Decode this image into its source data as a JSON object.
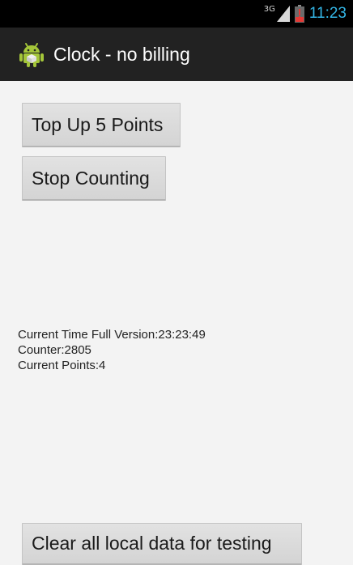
{
  "status_bar": {
    "network_type": "3G",
    "time": "11:23",
    "clock_color": "#33b5e5",
    "icons": [
      "signal-icon",
      "battery-low-icon"
    ]
  },
  "action_bar": {
    "app_icon": "android-icon",
    "title": "Clock - no billing"
  },
  "buttons": {
    "top_up": "Top Up 5 Points",
    "stop_counting": "Stop Counting",
    "clear_data": "Clear all local data for testing"
  },
  "info": {
    "current_time": "Current Time Full Version:23:23:49",
    "counter": "Counter:2805",
    "current_points": "Current Points:4"
  }
}
